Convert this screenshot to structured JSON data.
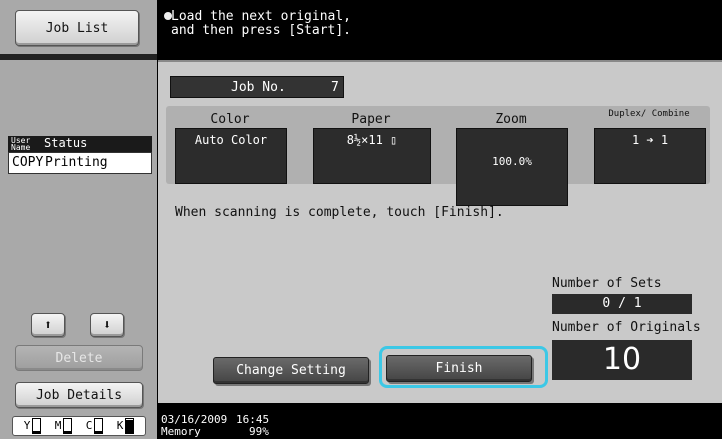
{
  "left_panel": {
    "job_list_label": "Job List",
    "table_headers": {
      "user_name": "User Name",
      "status": "Status"
    },
    "table_rows": [
      {
        "user": "COPY",
        "status": "Printing"
      }
    ],
    "arrow_up_glyph": "⬆",
    "arrow_down_glyph": "⬇",
    "delete_label": "Delete",
    "job_details_label": "Job Details",
    "toner": [
      {
        "label": "Y",
        "level": 0.15
      },
      {
        "label": "M",
        "level": 0.15
      },
      {
        "label": "C",
        "level": 0.15
      },
      {
        "label": "K",
        "level": 0.95
      }
    ]
  },
  "message": {
    "line1": "Load the next original,",
    "line2": "and then press [Start]."
  },
  "job": {
    "label": "Job No.",
    "number": "7"
  },
  "settings": {
    "color": {
      "label": "Color",
      "value": "Auto Color"
    },
    "paper": {
      "label": "Paper",
      "value": "8½×11 ▯"
    },
    "zoom": {
      "label": "Zoom",
      "value": "100.0%"
    },
    "duplex": {
      "label": "Duplex/ Combine",
      "value": "1 ➔ 1"
    }
  },
  "scan_message": "When scanning is complete, touch [Finish].",
  "number_of_sets": {
    "label": "Number of Sets",
    "value": "0 / 1"
  },
  "number_of_originals": {
    "label": "Number of Originals",
    "value": "10"
  },
  "buttons": {
    "change_setting": "Change Setting",
    "finish": "Finish"
  },
  "status_bar": {
    "date": "03/16/2009",
    "time": "16:45",
    "memory_label": "Memory",
    "memory_value": "99%"
  },
  "colors": {
    "highlight": "#3cc8e6",
    "panel_bg": "#c9c9c9",
    "dark_box": "#2c2c2c"
  }
}
